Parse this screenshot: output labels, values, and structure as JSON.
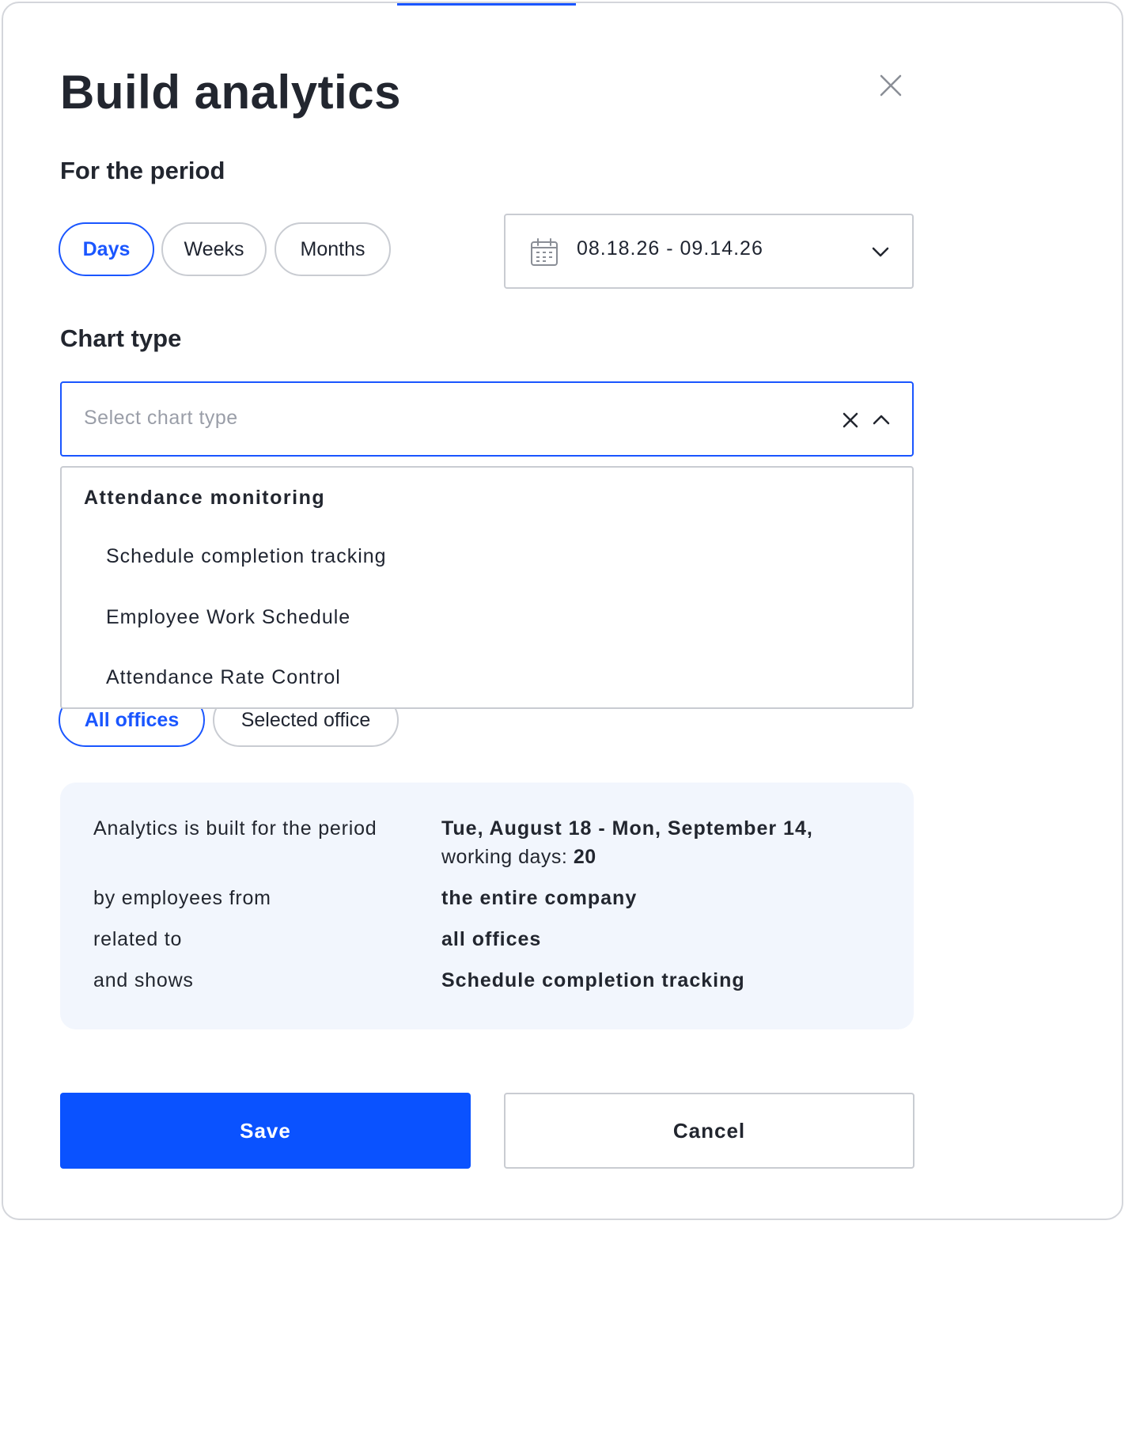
{
  "modal": {
    "title": "Build analytics",
    "close_icon": "close-icon"
  },
  "period": {
    "label": "For the period",
    "granularity": [
      {
        "label": "Days",
        "active": true
      },
      {
        "label": "Weeks",
        "active": false
      },
      {
        "label": "Months",
        "active": false
      }
    ],
    "date_range": "08.18.26 - 09.14.26",
    "date_icon": "calendar-icon"
  },
  "chart_type": {
    "label": "Chart type",
    "placeholder": "Select chart type",
    "dropdown": {
      "group": "Attendance monitoring",
      "options": [
        "Schedule completion tracking",
        "Employee Work Schedule",
        "Attendance Rate Control"
      ]
    }
  },
  "offices": {
    "options": [
      {
        "label": "All offices",
        "active": true
      },
      {
        "label": "Selected office",
        "active": false
      }
    ]
  },
  "summary": {
    "period_label": "Analytics is built for the period",
    "period_value": "Tue, August 18 - Mon, September 14,",
    "working_days_label": "working days:",
    "working_days_value": "20",
    "employees_label": "by employees from",
    "employees_value": "the entire company",
    "related_label": "related to",
    "related_value": "all offices",
    "shows_label": "and shows",
    "shows_value": "Schedule completion tracking"
  },
  "actions": {
    "save_label": "Save",
    "cancel_label": "Cancel"
  },
  "colors": {
    "accent": "#1a56ff",
    "save_button": "#0a52ff",
    "summary_background": "#f2f6fd",
    "border": "#c9ccd2",
    "text": "#22262f",
    "placeholder": "#9a9ea8"
  }
}
